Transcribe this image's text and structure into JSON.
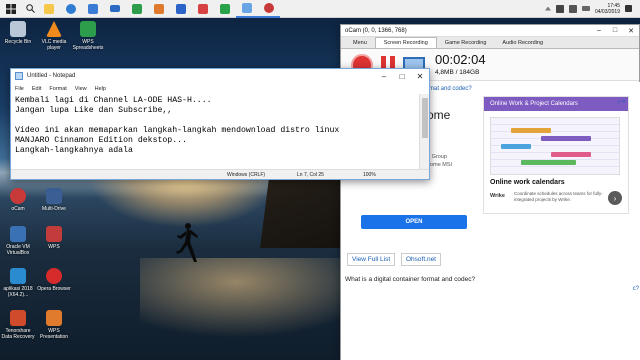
{
  "taskbar": {
    "clock_time": "17:45",
    "clock_date": "04/03/2019",
    "apps": [
      {
        "name": "file-explorer",
        "color": "#f5c74a"
      },
      {
        "name": "edge",
        "color": "#2f7cd3"
      },
      {
        "name": "store",
        "color": "#3a7bd5"
      },
      {
        "name": "mail",
        "color": "#2b6cc2"
      },
      {
        "name": "wps-spreadsheets",
        "color": "#2d9d4b"
      },
      {
        "name": "wps-presentation",
        "color": "#e07b2d"
      },
      {
        "name": "wps-writer",
        "color": "#2b63c7"
      },
      {
        "name": "app-red",
        "color": "#d64141"
      },
      {
        "name": "app-green",
        "color": "#2aa24a"
      },
      {
        "name": "notepad",
        "color": "#6aa6e6"
      },
      {
        "name": "ocam",
        "color": "#c83a3a"
      }
    ]
  },
  "desktop": {
    "icons": [
      {
        "id": "recycle-bin",
        "label": "Recycle Bin",
        "color": "#b9c7d6"
      },
      {
        "id": "vlc",
        "label": "VLC media player",
        "color": "#f08a1c"
      },
      {
        "id": "wps-spreadsheets",
        "label": "WPS Spreadsheets",
        "color": "#2d9d4b"
      },
      {
        "id": "ocam",
        "label": "oCam",
        "color": "#c83a3a"
      },
      {
        "id": "multi-drive",
        "label": "Multi-Drive",
        "color": "#3b5f94"
      },
      {
        "id": "oracle-vm",
        "label": "Oracle VM VirtualBox",
        "color": "#3a71b5"
      },
      {
        "id": "wps",
        "label": "WPS",
        "color": "#c33c3c"
      },
      {
        "id": "aplikasi",
        "label": "aplikasi 2018 (X64.2)...",
        "color": "#2a8bd0"
      },
      {
        "id": "opera",
        "label": "Opera Browser",
        "color": "#d62b2b"
      },
      {
        "id": "tenorshare",
        "label": "Tenorshare Data Recovery",
        "color": "#d04b2b"
      },
      {
        "id": "wps-presentation",
        "label": "WPS Presentation",
        "color": "#e07b2d"
      }
    ]
  },
  "notepad": {
    "title": "Untitled - Notepad",
    "menu": [
      "File",
      "Edit",
      "Format",
      "View",
      "Help"
    ],
    "lines": [
      "Kembali lagi di Channel LA-ODE HAS-H....",
      "Jangan lupa Like dan Subscribe,,",
      "",
      "Video ini akan memaparkan langkah-langkah mendownload distro linux",
      "MANJARO Cinnamon Edition dekstop...",
      "Langkah-langkahnya adala"
    ],
    "status": {
      "encoding": "Windows (CRLF)",
      "position": "Ln 7, Col 25",
      "zoom": "100%"
    }
  },
  "ocam": {
    "title": "oCam (0, 0, 1366, 768)",
    "tabs": [
      "Menu",
      "Screen Recording",
      "Game Recording",
      "Audio Recording"
    ],
    "active_tab": "Screen Recording",
    "elapsed": "00:02:04",
    "size": "4,8MB / 184GB",
    "browser": {
      "link_top": "rmat and codec?",
      "heading_fragment": "ome",
      "group_line1": "d Group",
      "group_line2": "home MSI",
      "ad": {
        "header": "Online Work & Project Calendars",
        "title": "Online work calendars",
        "logo": "Wrike",
        "description": "Coordinate schedules across teams for fully-integrated projects by Wrike.",
        "arrow": "›",
        "badge": "▷✕"
      },
      "open_button": "OPEN",
      "view_full_list": "View Full List",
      "ohsoft": "Ohsoft.net",
      "question": "What is a digital container format and codec?",
      "right_link": "c?"
    }
  }
}
